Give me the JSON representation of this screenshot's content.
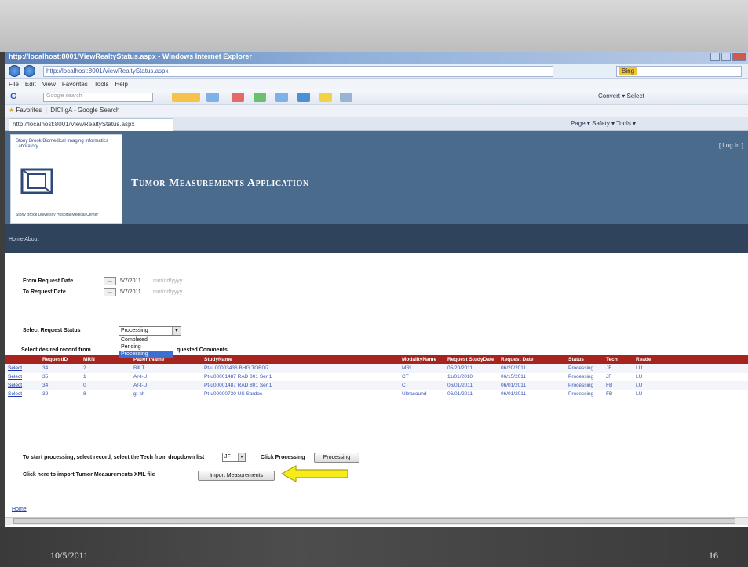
{
  "slide": {
    "date": "10/5/2011",
    "number": "16"
  },
  "browser": {
    "title": "http://localhost:8001/ViewRealtyStatus.aspx - Windows Internet Explorer",
    "address": "http://localhost:8001/ViewRealtyStatus.aspx",
    "search_placeholder": "Bing",
    "menu": [
      "File",
      "Edit",
      "View",
      "Favorites",
      "Tools",
      "Help"
    ],
    "google_placeholder": "Google search",
    "toolbar_right": "Convert ▾  Select",
    "favorites_label": "Favorites",
    "favorites_items": [
      "DICI gA - Google Search"
    ],
    "tab_title": "http://localhost:8001/ViewRealtyStatus.aspx",
    "command_bar": "Page ▾  Safety ▾  Tools ▾"
  },
  "app": {
    "logo_text_top": "Stony Brook Biomedical Imaging Informatics Laboratory",
    "logo_text_bottom": "Stony Brook University Hospital Medical Center",
    "title": "Tumor Measurements Application",
    "login": "[ Log In ]",
    "nav_menu": "Home   About"
  },
  "form": {
    "from_label": "From Request Date",
    "from_value": "5/7/2011",
    "from_hint": "mm/dd/yyyy",
    "to_label": "To Request Date",
    "to_value": "5/7/2011",
    "to_hint": "mm/dd/yyyy",
    "status_label": "Select Request Status",
    "status_value": "Processing",
    "status_options": [
      "Completed",
      "Pending",
      "Processing"
    ],
    "selected_option": "Processing",
    "instruction": "Select desired record from",
    "instruction_tail": "quested Comments",
    "cal_button": "..."
  },
  "grid": {
    "headers": [
      "RequestID",
      "MRN",
      "PatientName",
      "StudyName",
      "ModalityName",
      "Request StudyDate",
      "Request Date",
      "Status",
      "Tech",
      "Reade"
    ],
    "select_label": "Select",
    "rows": [
      [
        "34",
        "2",
        "Bill T",
        "Pt-u 00003436 BHG TOB0I7",
        "MRI",
        "05/20/2011",
        "06/20/2011",
        "Processing",
        "JF",
        "LU"
      ],
      [
        "35",
        "1",
        "Ar-t-U",
        "Pt-u00001487 RAD 801 Ser 1",
        "CT",
        "11/01/2010",
        "06/15/2011",
        "Processing",
        "JF",
        "LU"
      ],
      [
        "34",
        "0",
        "Ar-t-U",
        "Pt-u00001487 RAD 801 Ser 1",
        "CT",
        "06/01/2011",
        "06/01/2011",
        "Processing",
        "FB",
        "LU"
      ],
      [
        "39",
        "8",
        "gt-ch",
        "Pt-u00000730 US Sardoc",
        "Ultrasound",
        "06/01/2011",
        "06/01/2011",
        "Processing",
        "FB",
        "LU"
      ]
    ]
  },
  "actions": {
    "start_text": "To start processing, select record, select the Tech from dropdown list",
    "tech_value": "JF",
    "click_processing": "Click Processing",
    "processing_button": "Processing",
    "import_text": "Click here to import Tumor Measurements XML file",
    "import_button": "Import Measurements",
    "home_link": "Home"
  },
  "colors": {
    "header": "#4b6b8d",
    "navbar": "#2f445c",
    "grid_header": "#a6241d",
    "callout": "#f5ec1a"
  }
}
